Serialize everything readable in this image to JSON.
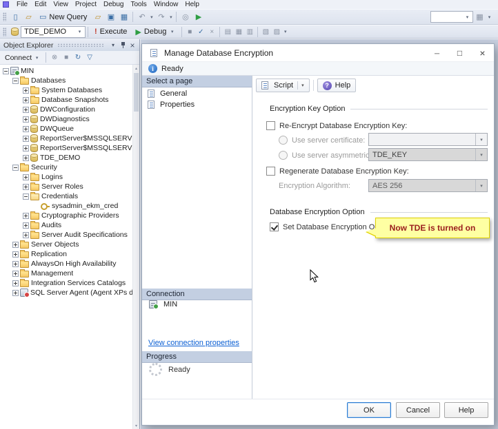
{
  "colors": {
    "callout_bg": "#feffa3",
    "callout_text": "#9a1c1c",
    "section_header_bg": "#c3cfe2",
    "link_color": "#0b5fd3",
    "folder_icon": "#f5c863",
    "status_ok_green": "#43a047"
  },
  "menu": {
    "items": [
      "File",
      "Edit",
      "View",
      "Project",
      "Debug",
      "Tools",
      "Window",
      "Help"
    ]
  },
  "toolbar_standard": {
    "new_query_label": "New Query",
    "icons": {
      "new_file": "▯",
      "open_file": "▱",
      "new_query": "▭",
      "open_query": "▱",
      "save": "▣",
      "save_all": "▦",
      "undo": "↶",
      "redo": "↷",
      "dropdown": "▾",
      "activity_monitor": "◎",
      "start": "▶",
      "overflow": "▾"
    }
  },
  "toolbar_sql": {
    "available_database": "TDE_DEMO",
    "execute_label": "Execute",
    "debug_label": "Debug",
    "icons": {
      "execute_bang": "!",
      "debug_play": "▶",
      "dropdown": "▾",
      "stop": "■",
      "parse": "✓",
      "cancel_query": "×",
      "results_text": "▤",
      "results_grid": "▦",
      "results_file": "▥",
      "estimated_plan": "▧",
      "actual_plan": "▨",
      "overflow": "▾"
    }
  },
  "object_explorer": {
    "title": "Object Explorer",
    "connect_label": "Connect",
    "toolbar_icons": {
      "connect_chevron": "▾",
      "disconnect": "⊗",
      "stop": "■",
      "refresh": "↻",
      "filter": "▽"
    },
    "tree": [
      "MIN",
      "Databases",
      "System Databases",
      "Database Snapshots",
      "DWConfiguration",
      "DWDiagnostics",
      "DWQueue",
      "ReportServer$MSSQLSERVER",
      "ReportServer$MSSQLSERVER",
      "TDE_DEMO",
      "Security",
      "Logins",
      "Server Roles",
      "Credentials",
      "sysadmin_ekm_cred",
      "Cryptographic Providers",
      "Audits",
      "Server Audit Specifications",
      "Server Objects",
      "Replication",
      "AlwaysOn High Availability",
      "Management",
      "Integration Services Catalogs",
      "SQL Server Agent (Agent XPs disabled)"
    ]
  },
  "dialog": {
    "title": "Manage Database Encryption",
    "status": "Ready",
    "pages_header": "Select a page",
    "pages": [
      "General",
      "Properties"
    ],
    "script_label": "Script",
    "help_label": "Help",
    "groups": {
      "encryption_key": "Encryption Key Option",
      "database_encryption": "Database Encryption Option"
    },
    "fields": {
      "re_encrypt_label": "Re-Encrypt Database Encryption Key:",
      "use_certificate_label": "Use server certificate:",
      "certificate_value": "",
      "use_asymmetric_label": "Use server asymmetric key:",
      "asymmetric_value": "TDE_KEY",
      "regenerate_label": "Regenerate Database Encryption Key:",
      "algorithm_label": "Encryption Algorithm:",
      "algorithm_value": "AES 256",
      "set_encryption_label": "Set Database Encryption On"
    },
    "callout_text": "Now TDE is turned on",
    "connection": {
      "header": "Connection",
      "server": "MIN",
      "link": "View connection properties"
    },
    "progress": {
      "header": "Progress",
      "status": "Ready"
    },
    "buttons": {
      "ok": "OK",
      "cancel": "Cancel",
      "help": "Help"
    }
  }
}
